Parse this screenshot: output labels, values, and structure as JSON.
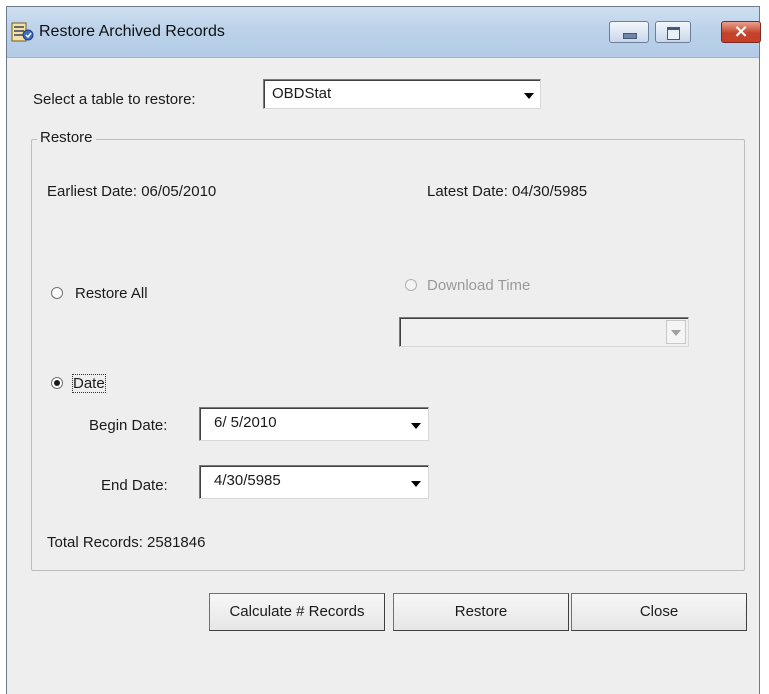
{
  "window": {
    "title": "Restore Archived Records",
    "close_glyph": "×"
  },
  "table_select": {
    "label": "Select a table to restore:",
    "value": "OBDStat"
  },
  "restore_group": {
    "legend": "Restore",
    "earliest": "Earliest Date: 06/05/2010",
    "latest": "Latest Date: 04/30/5985",
    "restore_all_label": "Restore All",
    "download_time_label": "Download Time",
    "date_label": "Date",
    "begin_label": "Begin Date:",
    "begin_value": "6/ 5/2010",
    "end_label": "End Date:",
    "end_value": "4/30/5985",
    "total_records": "Total Records: 2581846"
  },
  "buttons": {
    "calculate": "Calculate # Records",
    "restore": "Restore",
    "close": "Close"
  }
}
